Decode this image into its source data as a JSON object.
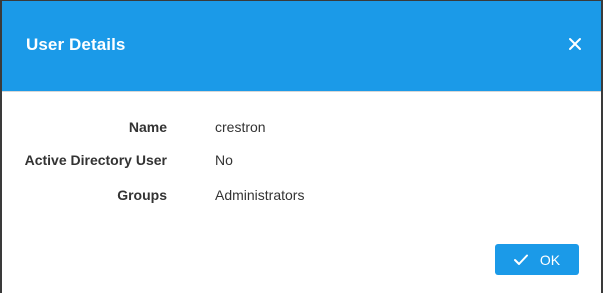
{
  "dialog": {
    "title": "User Details",
    "close_icon": "close-icon"
  },
  "details": [
    {
      "label": "Name",
      "value": "crestron"
    },
    {
      "label": "Active Directory User",
      "value": "No"
    },
    {
      "label": "Groups",
      "value": "Administrators"
    }
  ],
  "footer": {
    "ok_label": "OK",
    "ok_icon": "checkmark-icon"
  },
  "colors": {
    "accent": "#1b9ae8",
    "text": "#333333"
  }
}
